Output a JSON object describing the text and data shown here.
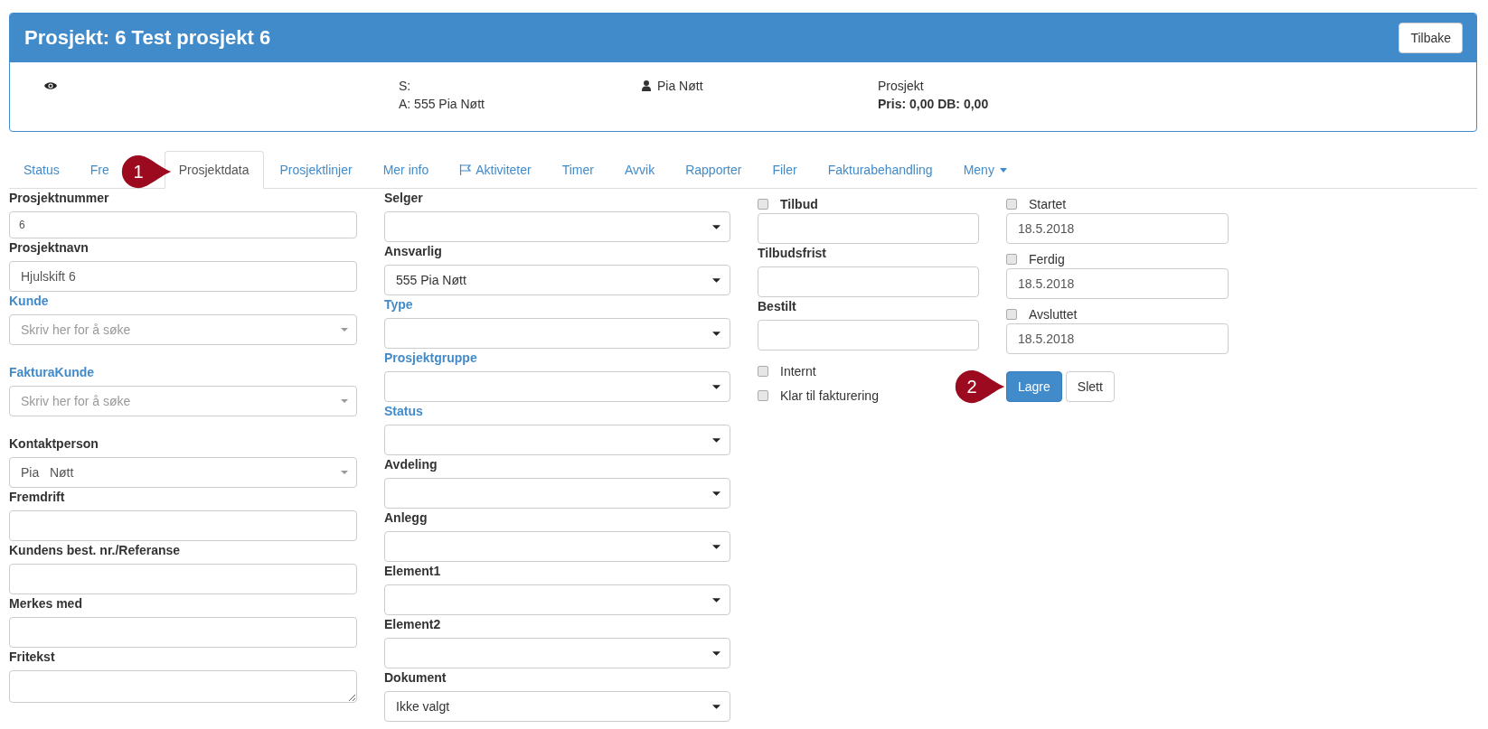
{
  "header": {
    "title": "Prosjekt: 6 Test prosjekt 6",
    "back_button": "Tilbake"
  },
  "summary": {
    "s_line": "S:",
    "a_line": "A: 555 Pia Nøtt",
    "person": "Pia Nøtt",
    "type": "Prosjekt",
    "price_line": "Pris: 0,00 DB: 0,00"
  },
  "tabs": [
    {
      "label": "Status",
      "selected": false,
      "kind": "plain"
    },
    {
      "label": "Fre",
      "selected": false,
      "kind": "plain"
    },
    {
      "label": "Prosjektdata",
      "selected": true,
      "kind": "plain"
    },
    {
      "label": "Prosjektlinjer",
      "selected": false,
      "kind": "plain"
    },
    {
      "label": "Mer info",
      "selected": false,
      "kind": "plain"
    },
    {
      "label": "Aktiviteter",
      "selected": false,
      "kind": "flag"
    },
    {
      "label": "Timer",
      "selected": false,
      "kind": "plain"
    },
    {
      "label": "Avvik",
      "selected": false,
      "kind": "plain"
    },
    {
      "label": "Rapporter",
      "selected": false,
      "kind": "plain"
    },
    {
      "label": "Filer",
      "selected": false,
      "kind": "plain"
    },
    {
      "label": "Fakturabehandling",
      "selected": false,
      "kind": "plain"
    },
    {
      "label": "Meny",
      "selected": false,
      "kind": "dropdown"
    }
  ],
  "tabs_callout": {
    "number": "1"
  },
  "columns": [
    {
      "fields": [
        {
          "kind": "small-text",
          "label": "Prosjektnummer",
          "value": "6"
        },
        {
          "kind": "text",
          "label": "Prosjektnavn",
          "value": "Hjulskift 6"
        },
        {
          "kind": "search-select",
          "label": "Kunde",
          "label_link": true,
          "placeholder": "Skriv her for å søke"
        },
        {
          "kind": "search-select",
          "label": "FakturaKunde",
          "label_link": true,
          "placeholder": "Skriv her for å søke"
        },
        {
          "kind": "search-select",
          "label": "Kontaktperson",
          "value": "Pia   Nøtt"
        },
        {
          "kind": "text",
          "label": "Fremdrift"
        },
        {
          "kind": "text",
          "label": "Kundens best. nr./Referanse"
        },
        {
          "kind": "text",
          "label": "Merkes med"
        },
        {
          "kind": "textarea",
          "label": "Fritekst"
        }
      ]
    },
    {
      "fields": [
        {
          "kind": "select",
          "label": "Selger"
        },
        {
          "kind": "select",
          "label": "Ansvarlig",
          "value": "555 Pia Nøtt"
        },
        {
          "kind": "select",
          "label": "Type",
          "label_link": true
        },
        {
          "kind": "select",
          "label": "Prosjektgruppe",
          "label_link": true
        },
        {
          "kind": "select",
          "label": "Status",
          "label_link": true
        },
        {
          "kind": "select",
          "label": "Avdeling"
        },
        {
          "kind": "select",
          "label": "Anlegg"
        },
        {
          "kind": "select",
          "label": "Element1"
        },
        {
          "kind": "select",
          "label": "Element2"
        },
        {
          "kind": "select",
          "label": "Dokument",
          "value": "Ikke valgt"
        }
      ]
    },
    {
      "fields": [
        {
          "kind": "check-field",
          "label": "Tilbud",
          "bold": true,
          "checked": false
        },
        {
          "kind": "text",
          "label": "Tilbudsfrist"
        },
        {
          "kind": "text",
          "label": "Bestilt"
        },
        {
          "kind": "checkbox",
          "label": "Internt",
          "checked": false
        },
        {
          "kind": "checkbox",
          "label": "Klar til fakturering",
          "checked": false
        }
      ]
    },
    {
      "fields": [
        {
          "kind": "check-field",
          "label": "Startet",
          "bold": false,
          "checked": false,
          "value": "18.5.2018"
        },
        {
          "kind": "check-field",
          "label": "Ferdig",
          "bold": false,
          "checked": false,
          "value": "18.5.2018"
        },
        {
          "kind": "check-field",
          "label": "Avsluttet",
          "bold": false,
          "checked": false,
          "value": "18.5.2018"
        },
        {
          "kind": "buttons",
          "buttons": [
            {
              "label": "Lagre",
              "kind": "primary"
            },
            {
              "label": "Slett",
              "kind": "default"
            }
          ],
          "callout": {
            "number": "2"
          }
        }
      ]
    }
  ]
}
